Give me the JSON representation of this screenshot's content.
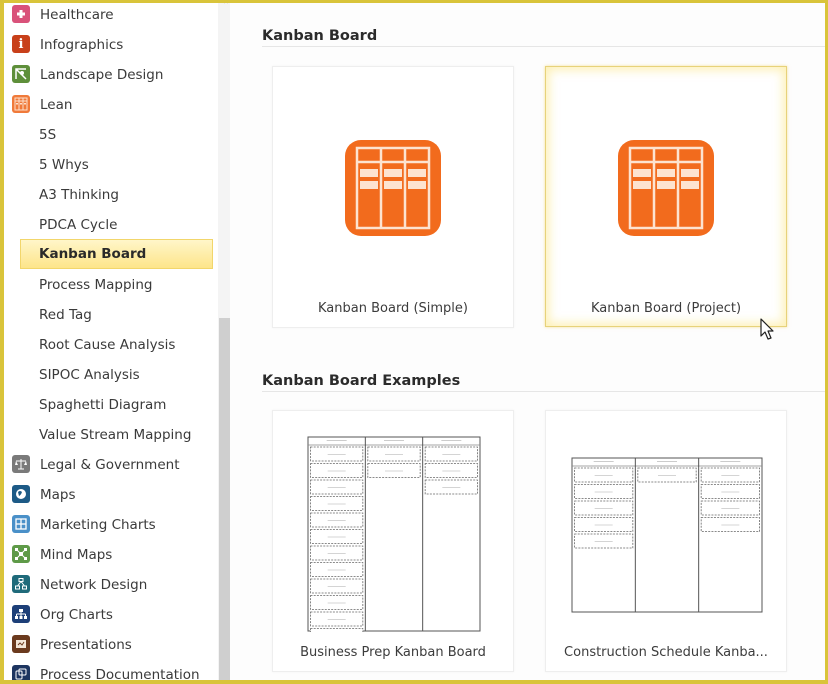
{
  "sidebar": {
    "categories_top": [
      {
        "label": "Healthcare",
        "icon": "healthcare-icon",
        "color": "#d9527a"
      },
      {
        "label": "Infographics",
        "icon": "infographics-icon",
        "color": "#c8401a"
      },
      {
        "label": "Landscape Design",
        "icon": "landscape-design-icon",
        "color": "#5e8f3a"
      },
      {
        "label": "Lean",
        "icon": "lean-icon",
        "color": "#f07a3a"
      }
    ],
    "lean_children": [
      {
        "label": "5S"
      },
      {
        "label": "5 Whys"
      },
      {
        "label": "A3 Thinking"
      },
      {
        "label": "PDCA Cycle"
      },
      {
        "label": "Kanban Board",
        "selected": true
      },
      {
        "label": "Process Mapping"
      },
      {
        "label": "Red Tag"
      },
      {
        "label": "Root Cause Analysis"
      },
      {
        "label": "SIPOC Analysis"
      },
      {
        "label": "Spaghetti Diagram"
      },
      {
        "label": "Value Stream Mapping"
      }
    ],
    "categories_bottom": [
      {
        "label": "Legal & Government",
        "icon": "legal-government-icon",
        "color": "#7a7a7a"
      },
      {
        "label": "Maps",
        "icon": "maps-icon",
        "color": "#1d5a86"
      },
      {
        "label": "Marketing Charts",
        "icon": "marketing-charts-icon",
        "color": "#4a90c8"
      },
      {
        "label": "Mind Maps",
        "icon": "mind-maps-icon",
        "color": "#5e9a48"
      },
      {
        "label": "Network Design",
        "icon": "network-design-icon",
        "color": "#1f6a7a"
      },
      {
        "label": "Org Charts",
        "icon": "org-charts-icon",
        "color": "#1d3f78"
      },
      {
        "label": "Presentations",
        "icon": "presentations-icon",
        "color": "#6b3a1e"
      },
      {
        "label": "Process Documentation",
        "icon": "process-documentation-icon",
        "color": "#1d3560"
      }
    ]
  },
  "main": {
    "templates_section": {
      "title": "Kanban Board",
      "cards": [
        {
          "caption": "Kanban Board (Simple)",
          "icon": "kanban-board-icon",
          "hovered": false
        },
        {
          "caption": "Kanban Board (Project)",
          "icon": "kanban-board-icon",
          "hovered": true
        }
      ]
    },
    "examples_section": {
      "title": "Kanban Board Examples",
      "cards": [
        {
          "caption": "Business Prep Kanban Board",
          "columns": 3,
          "cards_per_column": [
            12,
            2,
            3
          ]
        },
        {
          "caption": "Construction Schedule Kanba...",
          "columns": 3,
          "cards_per_column": [
            5,
            1,
            4
          ]
        }
      ]
    }
  },
  "colors": {
    "accent_orange": "#f26b1d",
    "selection_yellow": "#fde58a",
    "frame_yellow": "#d9c43a"
  }
}
